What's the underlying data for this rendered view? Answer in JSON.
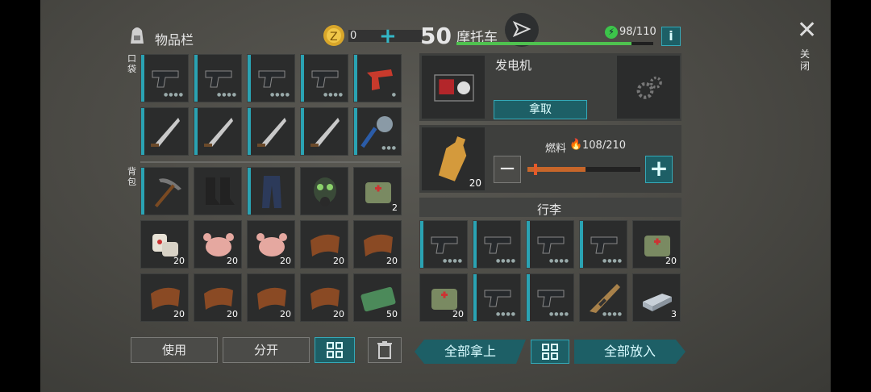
{
  "inventory": {
    "title": "物品栏",
    "coin_count": "0",
    "pocket_label": "口袋",
    "backpack_label": "背包"
  },
  "vehicle": {
    "level": "50",
    "name": "摩托车",
    "durability": "98/110"
  },
  "generator": {
    "name": "发电机",
    "take_label": "拿取"
  },
  "fuel": {
    "label": "燃料",
    "value": "108/210",
    "item_qty": "20",
    "level_fraction": 0.514
  },
  "luggage": {
    "title": "行李"
  },
  "buttons": {
    "use": "使用",
    "split": "分开",
    "take_all": "全部拿上",
    "put_all": "全部放入",
    "close": "关闭"
  },
  "inventory_items": {
    "row1": [
      "",
      "",
      "",
      "",
      ""
    ],
    "row2": [
      "",
      "",
      "",
      "",
      ""
    ],
    "row3": [
      "",
      "",
      "",
      "",
      "2"
    ],
    "row4": [
      "20",
      "20",
      "20",
      "20",
      "20"
    ],
    "row5": [
      "20",
      "20",
      "20",
      "20",
      "50"
    ]
  },
  "luggage_items": {
    "row1": [
      "",
      "",
      "",
      "",
      "20"
    ],
    "row2": [
      "20",
      "",
      "",
      "",
      "3"
    ]
  },
  "icons": {
    "coin": "coin-icon",
    "add": "plus-icon",
    "backpack": "backpack-icon",
    "gear": "gear-icon",
    "trash": "trash-icon",
    "grid": "grid-icon",
    "close": "close-icon",
    "lightning": "lightning-icon",
    "flame": "flame-icon"
  },
  "colors": {
    "accent": "#2aa3b3",
    "vehicle_bar": "#4fc24f",
    "fuel_bar": "#c7662a",
    "bg": "#4a4944"
  }
}
